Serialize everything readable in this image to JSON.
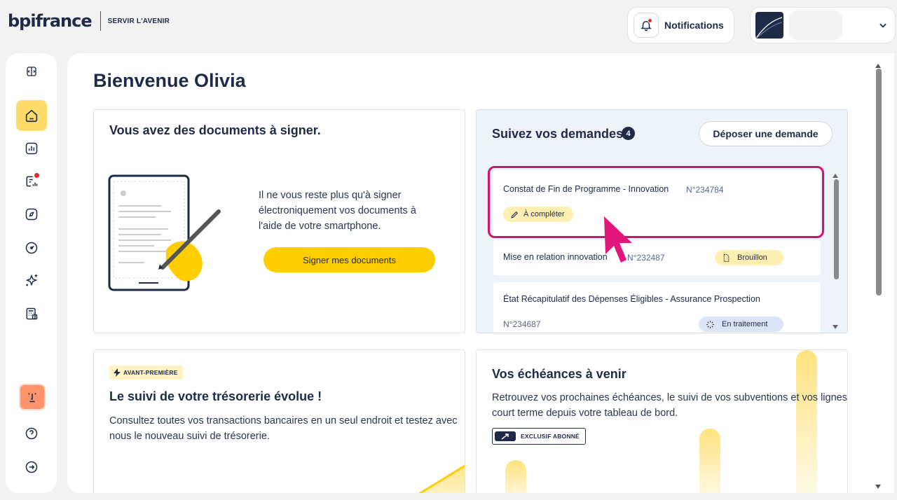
{
  "brand": {
    "name": "bpifrance",
    "tagline": "SERVIR L'AVENIR"
  },
  "header": {
    "notifications_label": "Notifications"
  },
  "sidebar": {
    "items": [
      {
        "icon": "panel-toggle-icon"
      },
      {
        "icon": "home-icon",
        "active": true
      },
      {
        "icon": "chart-icon"
      },
      {
        "icon": "document-chart-icon",
        "has_alert": true
      },
      {
        "icon": "compass-icon"
      },
      {
        "icon": "gauge-icon"
      },
      {
        "icon": "sparkles-icon"
      },
      {
        "icon": "calculator-icon"
      }
    ],
    "bottom": [
      {
        "icon": "help-icon"
      },
      {
        "icon": "logout-icon"
      }
    ]
  },
  "page": {
    "title": "Bienvenue Olivia"
  },
  "sign_card": {
    "title": "Vous avez des documents à signer.",
    "text": "Il ne vous reste plus qu'à signer électroniquement vos documents à l'aide de votre smartphone.",
    "button": "Signer mes documents"
  },
  "demandes": {
    "title": "Suivez vos demandes",
    "count": "4",
    "deposit_button": "Déposer une demande",
    "items": [
      {
        "title": "Constat de Fin de Programme - Innovation",
        "number": "N°234784",
        "status": "À compléter"
      },
      {
        "title": "Mise en relation innovation",
        "number": "N°232487",
        "status": "Brouillon"
      },
      {
        "title": "État Récapitulatif des Dépenses Éligibles - Assurance Prospection",
        "number": "N°234687",
        "status": "En traitement"
      }
    ]
  },
  "tresorerie": {
    "badge": "AVANT-PREMIÈRE",
    "title": "Le suivi de votre trésorerie évolue !",
    "text": "Consultez toutes vos transactions bancaires en un seul endroit et testez avec nous le nouveau suivi de trésorerie."
  },
  "echeances": {
    "title": "Vos échéances à venir",
    "text": "Retrouvez vos prochaines échéances, le suivi de vos subventions et vos lignes court terme depuis votre tableau de bord.",
    "badge": "EXCLUSIF ABONNÉ"
  },
  "colors": {
    "navy": "#1e2a48",
    "yellow": "#ffcd00",
    "highlight": "#d3126c"
  }
}
